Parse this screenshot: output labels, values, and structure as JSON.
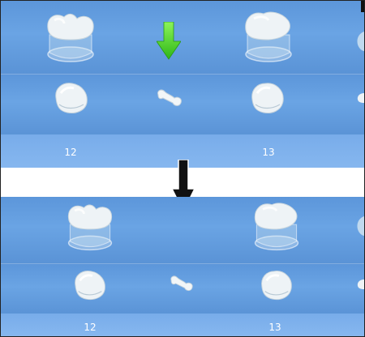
{
  "top_panel": {
    "labels": [
      {
        "tooth": "12"
      },
      {
        "tooth": "13"
      }
    ]
  },
  "bottom_panel": {
    "labels": [
      {
        "tooth": "12"
      },
      {
        "tooth": "13"
      }
    ]
  },
  "colors": {
    "background_blue": "#5b95d8",
    "label_band_blue": "#80b2ec",
    "green_arrow": "#49d12a",
    "transition_arrow": "#111111",
    "tooth_white": "#eef3f6"
  },
  "icons": {
    "top_marker": "green-down-arrow-icon",
    "transition": "black-down-arrow-icon"
  }
}
